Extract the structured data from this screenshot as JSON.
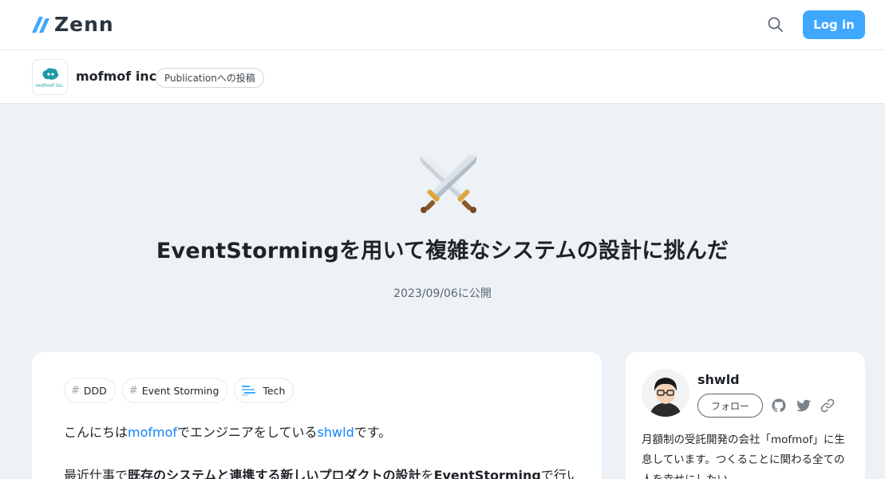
{
  "header": {
    "logo_text": "Zenn",
    "login_label": "Log in"
  },
  "publication": {
    "name": "mofmof inc.",
    "avatar_text": "mofmof inc.",
    "badge": "Publicationへの投稿"
  },
  "article": {
    "title": "EventStormingを用いて複雑なシステムの設計に挑んだ",
    "published": "2023/09/06に公開",
    "tags": [
      {
        "label": "DDD",
        "icon": "hash-icon"
      },
      {
        "label": "Event Storming",
        "icon": "hash-icon"
      },
      {
        "label": "Tech",
        "icon": "tech-icon"
      }
    ],
    "intro": {
      "prefix": "こんにちは",
      "link1": "mofmof",
      "middle": "でエンジニアをしている",
      "link2": "shwld",
      "suffix": "です。"
    },
    "para2": {
      "a": "最近仕事で",
      "b": "既存のシステムと連携する新しいプロダクトの設計",
      "c": "を",
      "d": "EventStorming",
      "e": "で行い"
    }
  },
  "author": {
    "name": "shwld",
    "follow_label": "フォロー",
    "bio": "月額制の受託開発の会社「mofmof」に生息しています。つくることに関わる全ての人を幸せにしたい"
  },
  "colors": {
    "accent": "#3ea8ff",
    "link": "#0f83fd",
    "background": "#edf2f7"
  }
}
